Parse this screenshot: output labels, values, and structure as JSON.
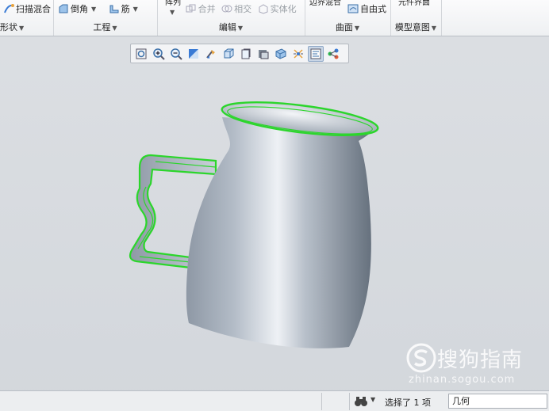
{
  "ribbon": {
    "groups": [
      {
        "label": "形状",
        "buttons": [
          "扫描混合"
        ]
      },
      {
        "label": "工程",
        "buttons": [
          "倒角",
          "筋"
        ]
      },
      {
        "label": "编辑",
        "top_cut": "阵列",
        "buttons": [
          "合并",
          "相交",
          "实体化"
        ]
      },
      {
        "label": "曲面",
        "top_cut": "边界混合",
        "buttons": [
          "自由式"
        ]
      },
      {
        "label": "模型意图",
        "top_cut": "元件界面",
        "buttons": []
      }
    ]
  },
  "view_toolbar": {
    "icons": [
      "refit-icon",
      "zoom-in-icon",
      "zoom-out-icon",
      "reorient-icon",
      "saved-orientations-icon",
      "display-style-icon",
      "section-view-icon",
      "perspective-icon",
      "datum-display-icon",
      "spin-center-icon",
      "annotation-display-icon",
      "appearance-icon"
    ]
  },
  "colors": {
    "selection_highlight": "#2bd62b",
    "model_body": "#a6b0bd"
  },
  "statusbar": {
    "message": "选择了 1 项",
    "filter_value": "几何"
  },
  "watermark": {
    "text": "搜狗指南",
    "url": "zhinan.sogou.com"
  }
}
